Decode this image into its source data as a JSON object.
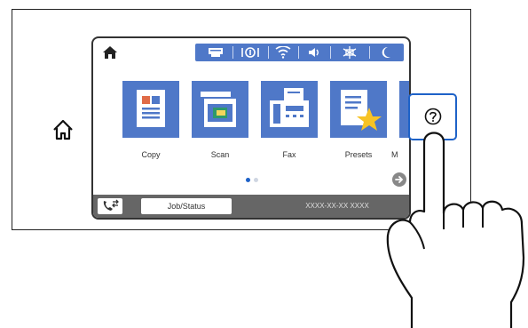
{
  "screen": {
    "status_icons": [
      "scan-to-device-icon",
      "network-usb-icon",
      "wifi-icon",
      "volume-icon",
      "eco-icon",
      "sleep-icon"
    ],
    "accent_color": "#4f78c8"
  },
  "tiles": [
    {
      "label": "Copy",
      "icon": "copy-icon"
    },
    {
      "label": "Scan",
      "icon": "scan-icon"
    },
    {
      "label": "Fax",
      "icon": "fax-icon"
    },
    {
      "label": "Presets",
      "icon": "presets-icon"
    },
    {
      "label": "M",
      "icon": "more-icon"
    }
  ],
  "pager": {
    "page": 1,
    "total": 2
  },
  "bottombar": {
    "job_status_label": "Job/Status",
    "datetime": "XXXX-XX-XX XXXX"
  },
  "highlight_color": "#1e62c8"
}
